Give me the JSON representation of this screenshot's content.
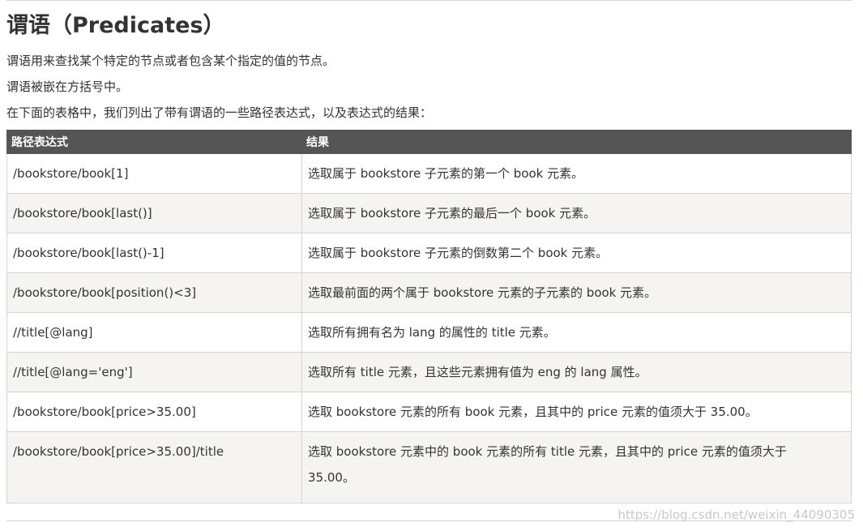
{
  "title": "谓语（Predicates）",
  "paragraphs": [
    "谓语用来查找某个特定的节点或者包含某个指定的值的节点。",
    "谓语被嵌在方括号中。",
    "在下面的表格中，我们列出了带有谓语的一些路径表达式，以及表达式的结果："
  ],
  "table": {
    "headers": [
      "路径表达式",
      "结果"
    ],
    "rows": [
      {
        "expr": "/bookstore/book[1]",
        "result": "选取属于 bookstore 子元素的第一个 book 元素。"
      },
      {
        "expr": "/bookstore/book[last()]",
        "result": "选取属于 bookstore 子元素的最后一个 book 元素。"
      },
      {
        "expr": "/bookstore/book[last()-1]",
        "result": "选取属于 bookstore 子元素的倒数第二个 book 元素。"
      },
      {
        "expr": "/bookstore/book[position()<3]",
        "result": "选取最前面的两个属于 bookstore 元素的子元素的 book 元素。"
      },
      {
        "expr": "//title[@lang]",
        "result": "选取所有拥有名为 lang 的属性的 title 元素。"
      },
      {
        "expr": "//title[@lang='eng']",
        "result": "选取所有 title 元素，且这些元素拥有值为 eng 的 lang 属性。"
      },
      {
        "expr": "/bookstore/book[price>35.00]",
        "result": "选取 bookstore 元素的所有 book 元素，且其中的 price 元素的值须大于 35.00。"
      },
      {
        "expr": "/bookstore/book[price>35.00]/title",
        "result_line1": "选取 bookstore 元素中的 book 元素的所有 title 元素，且其中的 price 元素的值须大于",
        "result_line2": "35.00。"
      }
    ]
  },
  "watermark": "https://blog.csdn.net/weixin_44090305",
  "colors": {
    "header_bg": "#555555",
    "alt_row_bg": "#f6f4f0",
    "border": "#d4d4d4",
    "text": "#333333"
  }
}
